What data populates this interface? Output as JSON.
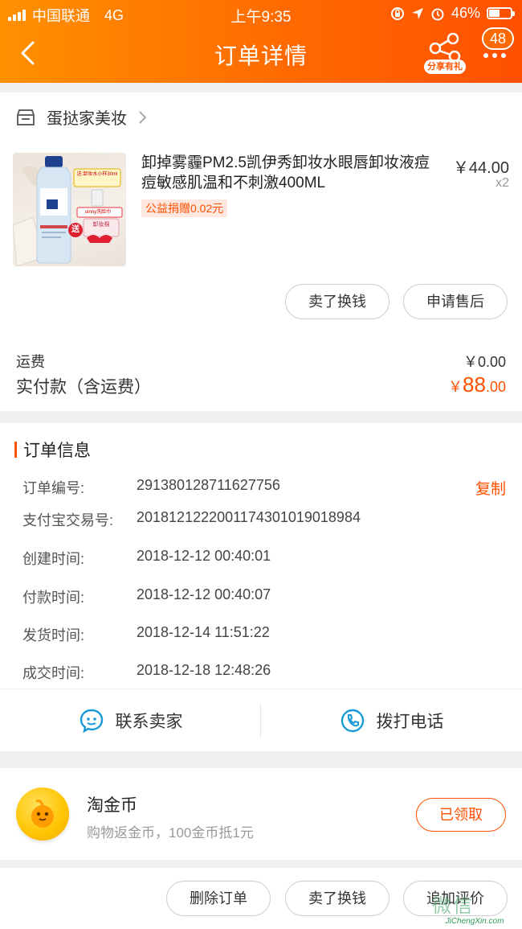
{
  "status_bar": {
    "carrier": "中国联通",
    "network": "4G",
    "time": "上午9:35",
    "battery": "46%",
    "battery_level": 0.46
  },
  "nav": {
    "title": "订单详情",
    "share_label": "分享有礼",
    "badge_count": "48"
  },
  "shop": {
    "name": "蛋挞家美妆"
  },
  "product": {
    "title": "卸掉雾霾PM2.5凯伊秀卸妆水眼唇卸妆液痘痘敏感肌温和不刺激400ML",
    "tag": "公益捐赠0.02元",
    "price": "￥44.00",
    "quantity": "x2",
    "image_label_1": "送:卸妆水小样30ml",
    "image_label_2": "uinny洗脸巾",
    "image_label_3": "卸妆棉",
    "image_label_4": "送"
  },
  "item_actions": {
    "sell_label": "卖了换钱",
    "after_sale_label": "申请售后"
  },
  "fees": {
    "shipping_label": "运费",
    "shipping_value": "￥0.00",
    "paid_label": "实付款（含运费）",
    "paid_symbol": "￥",
    "paid_int": "88",
    "paid_dec": ".00"
  },
  "order_info": {
    "title": "订单信息",
    "copy_label": "复制",
    "rows": [
      {
        "label": "订单编号:",
        "value": "291380128711627756"
      },
      {
        "label": "支付宝交易号:",
        "value": "2018121222001174301019018984"
      },
      {
        "label": "创建时间:",
        "value": "2018-12-12 00:40:01"
      },
      {
        "label": "付款时间:",
        "value": "2018-12-12 00:40:07"
      },
      {
        "label": "发货时间:",
        "value": "2018-12-14 11:51:22"
      },
      {
        "label": "成交时间:",
        "value": "2018-12-18 12:48:26"
      }
    ]
  },
  "contact": {
    "seller_label": "联系卖家",
    "phone_label": "拨打电话"
  },
  "coins": {
    "title": "淘金币",
    "subtitle": "购物返金币，100金币抵1元",
    "button_label": "已领取"
  },
  "bottom_actions": {
    "delete_label": "删除订单",
    "sell_label": "卖了换钱",
    "review_label": "追加评价"
  },
  "watermark": {
    "cn": "微信",
    "url": "JiChengXin.com"
  },
  "colors": {
    "accent": "#ff5000",
    "header_start": "#ff9000",
    "header_end": "#ff5000"
  }
}
